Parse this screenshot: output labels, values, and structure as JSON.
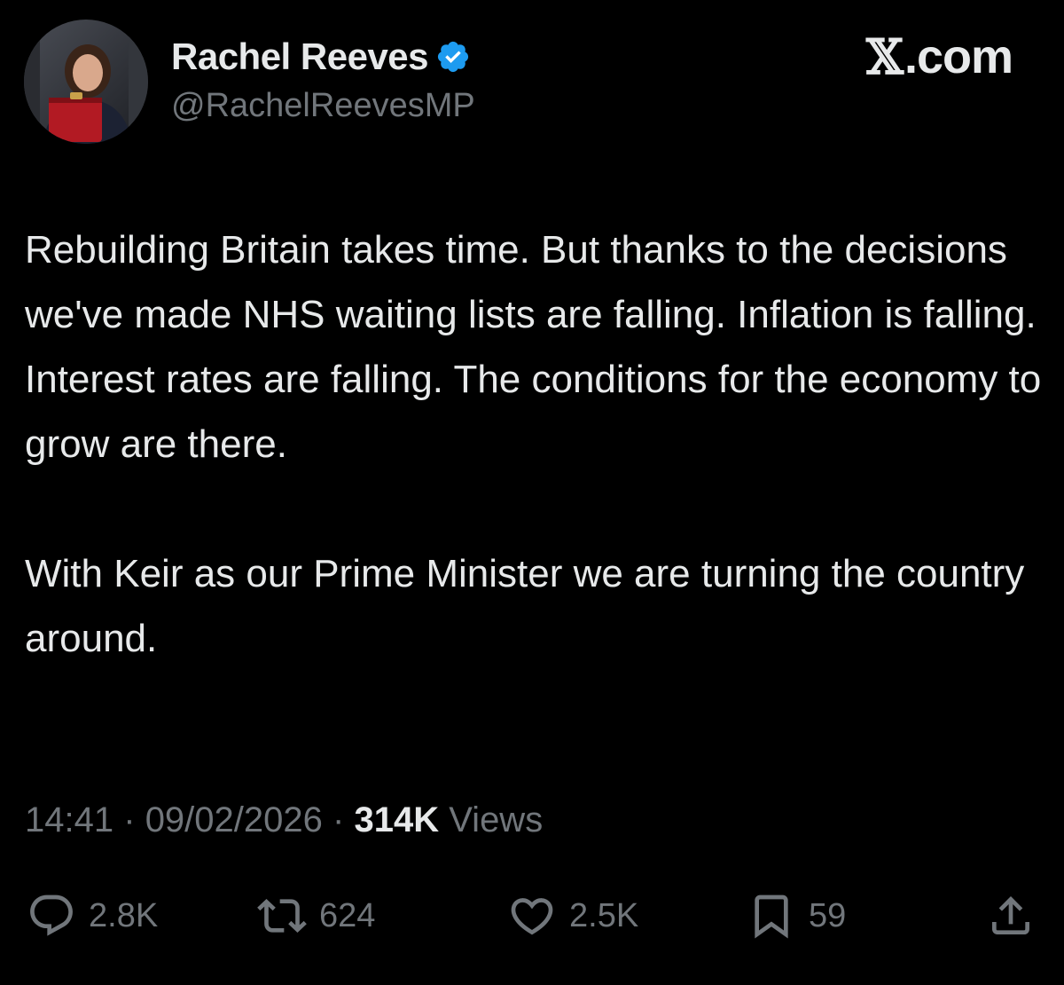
{
  "author": {
    "display_name": "Rachel Reeves",
    "handle": "@RachelReevesMP",
    "verified": true,
    "avatar_icon": "profile-photo"
  },
  "brand": {
    "label": ".com",
    "mark": "𝕏",
    "full": "X.com"
  },
  "tweet": {
    "paragraphs": [
      "Rebuilding Britain takes time. But thanks to the decisions we've made NHS waiting lists are falling. Inflation is falling. Interest rates are falling. The conditions for the economy to grow are there.",
      "With Keir as our Prime Minister we are turning the country around."
    ]
  },
  "meta": {
    "time": "14:41",
    "separator": "·",
    "date": "09/02/2026",
    "views_count": "314K",
    "views_label": "Views"
  },
  "actions": {
    "replies": "2.8K",
    "reposts": "624",
    "likes": "2.5K",
    "bookmarks": "59"
  },
  "colors": {
    "background": "#000000",
    "primary_text": "#e7e9ea",
    "secondary_text": "#71767b",
    "verified_badge": "#1d9bf0"
  }
}
